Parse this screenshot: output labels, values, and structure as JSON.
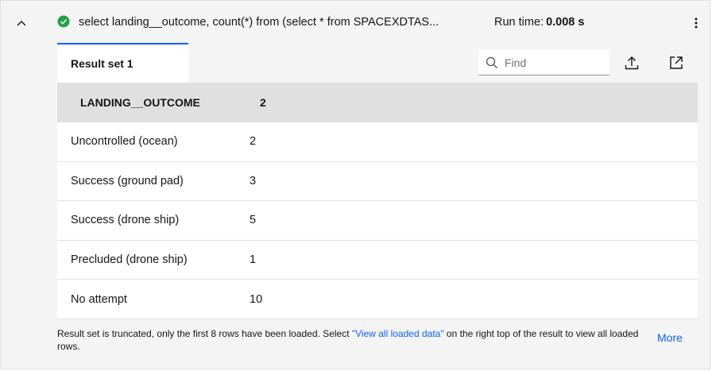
{
  "query": {
    "text": "select landing__outcome, count(*) from (select * from SPACEXDTAS...",
    "runtime_label": "Run time:",
    "runtime_value": "0.008 s",
    "status": "success"
  },
  "icons": {
    "collapse": "chevron-up-icon",
    "status": "checkmark-filled-icon",
    "overflow": "overflow-menu-vertical-icon",
    "search": "search-icon",
    "export": "upload-icon",
    "open": "launch-icon"
  },
  "colors": {
    "success": "#24a148",
    "link": "#0f62fe",
    "header_bg": "#e0e0e0",
    "panel_bg": "#f4f4f4"
  },
  "result": {
    "tab_label": "Result set 1",
    "find_placeholder": "Find",
    "columns": [
      "LANDING__OUTCOME",
      "2"
    ],
    "rows": [
      [
        "Uncontrolled (ocean)",
        "2"
      ],
      [
        "Success (ground pad)",
        "3"
      ],
      [
        "Success (drone ship)",
        "5"
      ],
      [
        "Precluded (drone ship)",
        "1"
      ],
      [
        "No attempt",
        "10"
      ]
    ]
  },
  "footer": {
    "notice_before": "Result set is truncated, only the first 8 rows have been loaded. Select ",
    "notice_link": "\"View all loaded data\"",
    "notice_after": " on the right top of the result to view all loaded rows.",
    "more_label": "More"
  }
}
